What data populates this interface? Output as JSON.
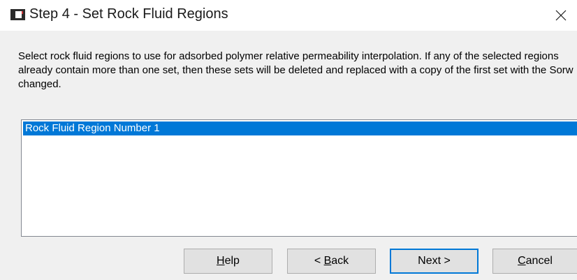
{
  "window": {
    "title": "Step 4 - Set Rock Fluid Regions",
    "icon": "app-window-icon",
    "close_icon": "close-icon"
  },
  "instructions": "Select rock fluid regions to use for adsorbed polymer relative permeability interpolation. If any of the selected regions already contain more than one set, then these sets will be deleted and replaced with a copy of the first set with the Sorw changed.",
  "regions": {
    "items": [
      {
        "label": "Rock Fluid Region Number 1",
        "selected": true
      }
    ]
  },
  "buttons": {
    "help": {
      "mnemonic": "H",
      "rest": "elp"
    },
    "back": {
      "prefix": "< ",
      "mnemonic": "B",
      "rest": "ack"
    },
    "next": {
      "label": "Next >",
      "is_default": true
    },
    "cancel": {
      "mnemonic": "C",
      "rest": "ancel"
    }
  },
  "colors": {
    "selection": "#0078d7",
    "dialog_bg": "#f0f0f0",
    "button_bg": "#e1e1e1"
  }
}
